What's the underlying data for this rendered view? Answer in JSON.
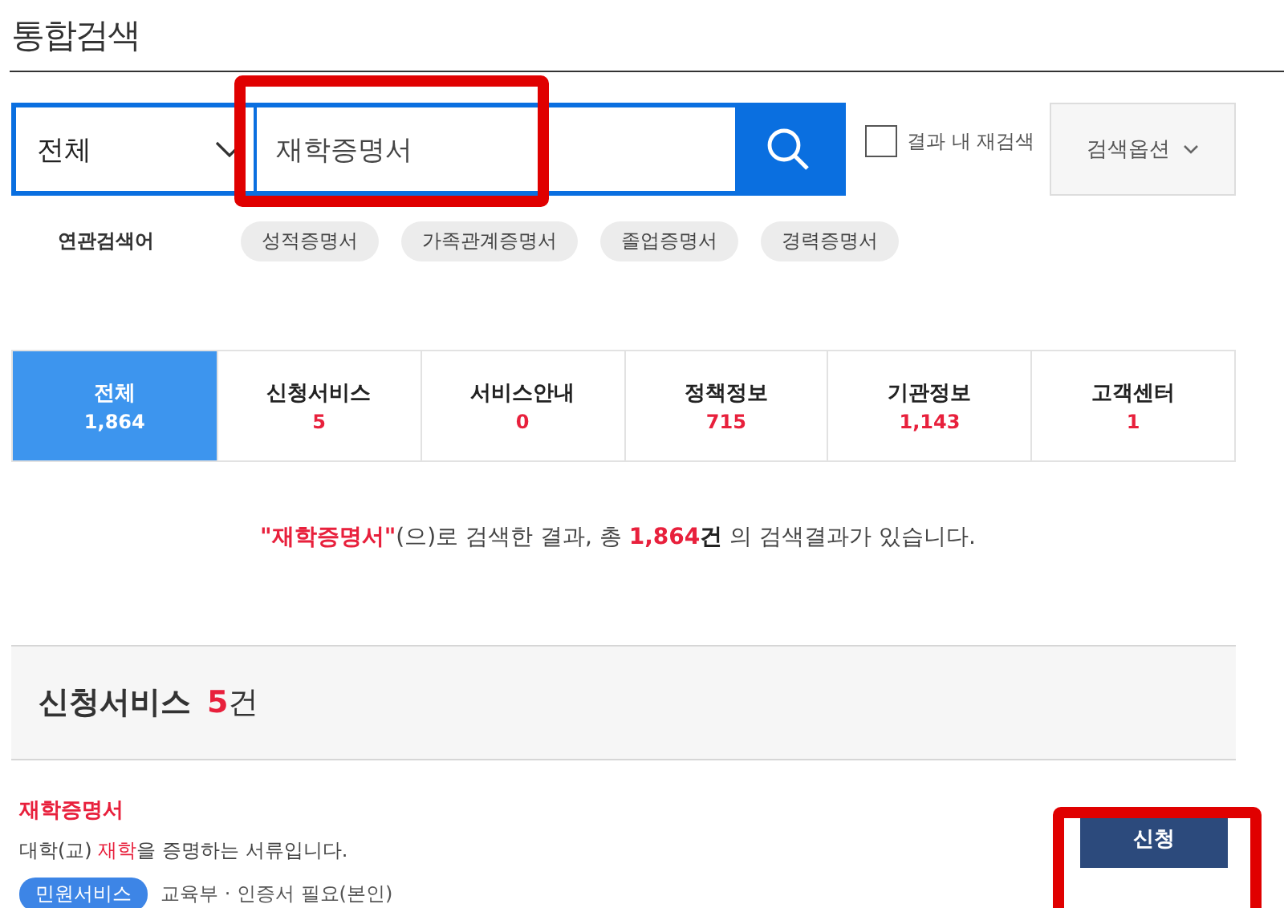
{
  "page_title": "통합검색",
  "search": {
    "scope": "전체",
    "value": "재학증명서",
    "recheck": {
      "label": "결과 내 재검색",
      "checked": false
    },
    "options_button": "검색옵션"
  },
  "related": {
    "label": "연관검색어",
    "keywords": [
      "성적증명서",
      "가족관계증명서",
      "졸업증명서",
      "경력증명서"
    ]
  },
  "tabs": [
    {
      "label": "전체",
      "count": "1,864",
      "selected": true
    },
    {
      "label": "신청서비스",
      "count": "5",
      "selected": false
    },
    {
      "label": "서비스안내",
      "count": "0",
      "selected": false
    },
    {
      "label": "정책정보",
      "count": "715",
      "selected": false
    },
    {
      "label": "기관정보",
      "count": "1,143",
      "selected": false
    },
    {
      "label": "고객센터",
      "count": "1",
      "selected": false
    }
  ],
  "summary": [
    {
      "kind": "keyword",
      "text": "\"재학증명서\""
    },
    {
      "kind": "plain",
      "text": "(으)로 검색한 결과, 총 "
    },
    {
      "kind": "count",
      "text": "1,864"
    },
    {
      "kind": "bold",
      "text": "건"
    },
    {
      "kind": "plain",
      "text": " 의 검색결과가 있습니다."
    }
  ],
  "section": {
    "title": "신청서비스",
    "count": "5",
    "unit": "건"
  },
  "results": [
    {
      "title": "재학증명서",
      "description": {
        "before": "대학(교) ",
        "highlight": "재학",
        "after": "을 증명하는 서류입니다."
      },
      "tag": "민원서비스",
      "meta": "교육부 · 인증서 필요(본인)",
      "button": "신청"
    }
  ]
}
